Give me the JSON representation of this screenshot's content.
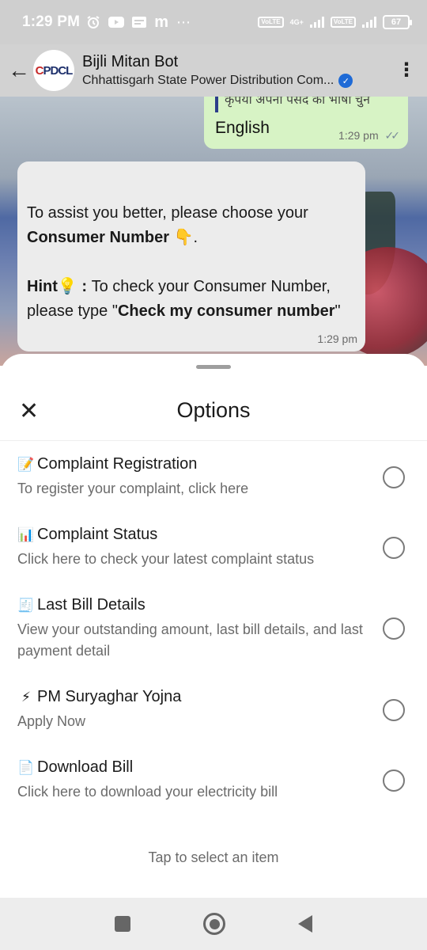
{
  "status_bar": {
    "time": "1:29 PM",
    "notification_icons": [
      "alarm-icon",
      "youtube-icon",
      "news-icon",
      "m-icon",
      "more-dots-icon"
    ],
    "dots": "⋯",
    "m_glyph": "m",
    "network_label_1": "VoLTE",
    "network_type": "4G+",
    "network_label_2": "VoLTE",
    "battery": "67"
  },
  "app_bar": {
    "back_glyph": "←",
    "avatar_text_left": "C",
    "avatar_text_right": "PDCL",
    "title": "Bijli Mitan Bot",
    "subtitle": "Chhattisgarh State Power Distribution Com...",
    "verified_glyph": "✓",
    "more_glyph": "⋮"
  },
  "chat": {
    "outgoing": {
      "quoted_text": "कृपया अपनी पसंद की भाषा चुने",
      "text": "English",
      "time": "1:29 pm",
      "ticks": "✓✓"
    },
    "incoming": {
      "line1": "To assist you better, please choose your",
      "line2_bold": "Consumer Number",
      "line2_emoji": "👇",
      "line2_end": ".",
      "hint_label": "Hint",
      "hint_emoji": "💡",
      "hint_colon": " : ",
      "hint_text": "To check your Consumer Number,",
      "hint_line2_start": "please type \"",
      "hint_line2_bold": "Check my consumer number",
      "hint_line2_end": "\"",
      "time": "1:29 pm"
    }
  },
  "sheet": {
    "close_glyph": "✕",
    "title": "Options",
    "hint": "Tap to select an item",
    "options": [
      {
        "emoji": "📝",
        "title": "Complaint Registration",
        "desc": "To register your complaint, click here"
      },
      {
        "emoji": "📊",
        "title": "Complaint Status",
        "desc": "Click here to check your latest complaint status"
      },
      {
        "emoji": "🧾",
        "title": " Last Bill Details",
        "desc": "View your outstanding amount, last bill details, and last payment detail"
      },
      {
        "emoji": "⚡",
        "title": "PM Suryaghar Yojna",
        "desc": "Apply Now"
      },
      {
        "emoji": "📄",
        "title": "Download Bill",
        "desc": "Click here to download your electricity bill"
      }
    ]
  },
  "nav_bar": {
    "buttons": [
      "recents-button",
      "home-button",
      "back-button"
    ]
  }
}
